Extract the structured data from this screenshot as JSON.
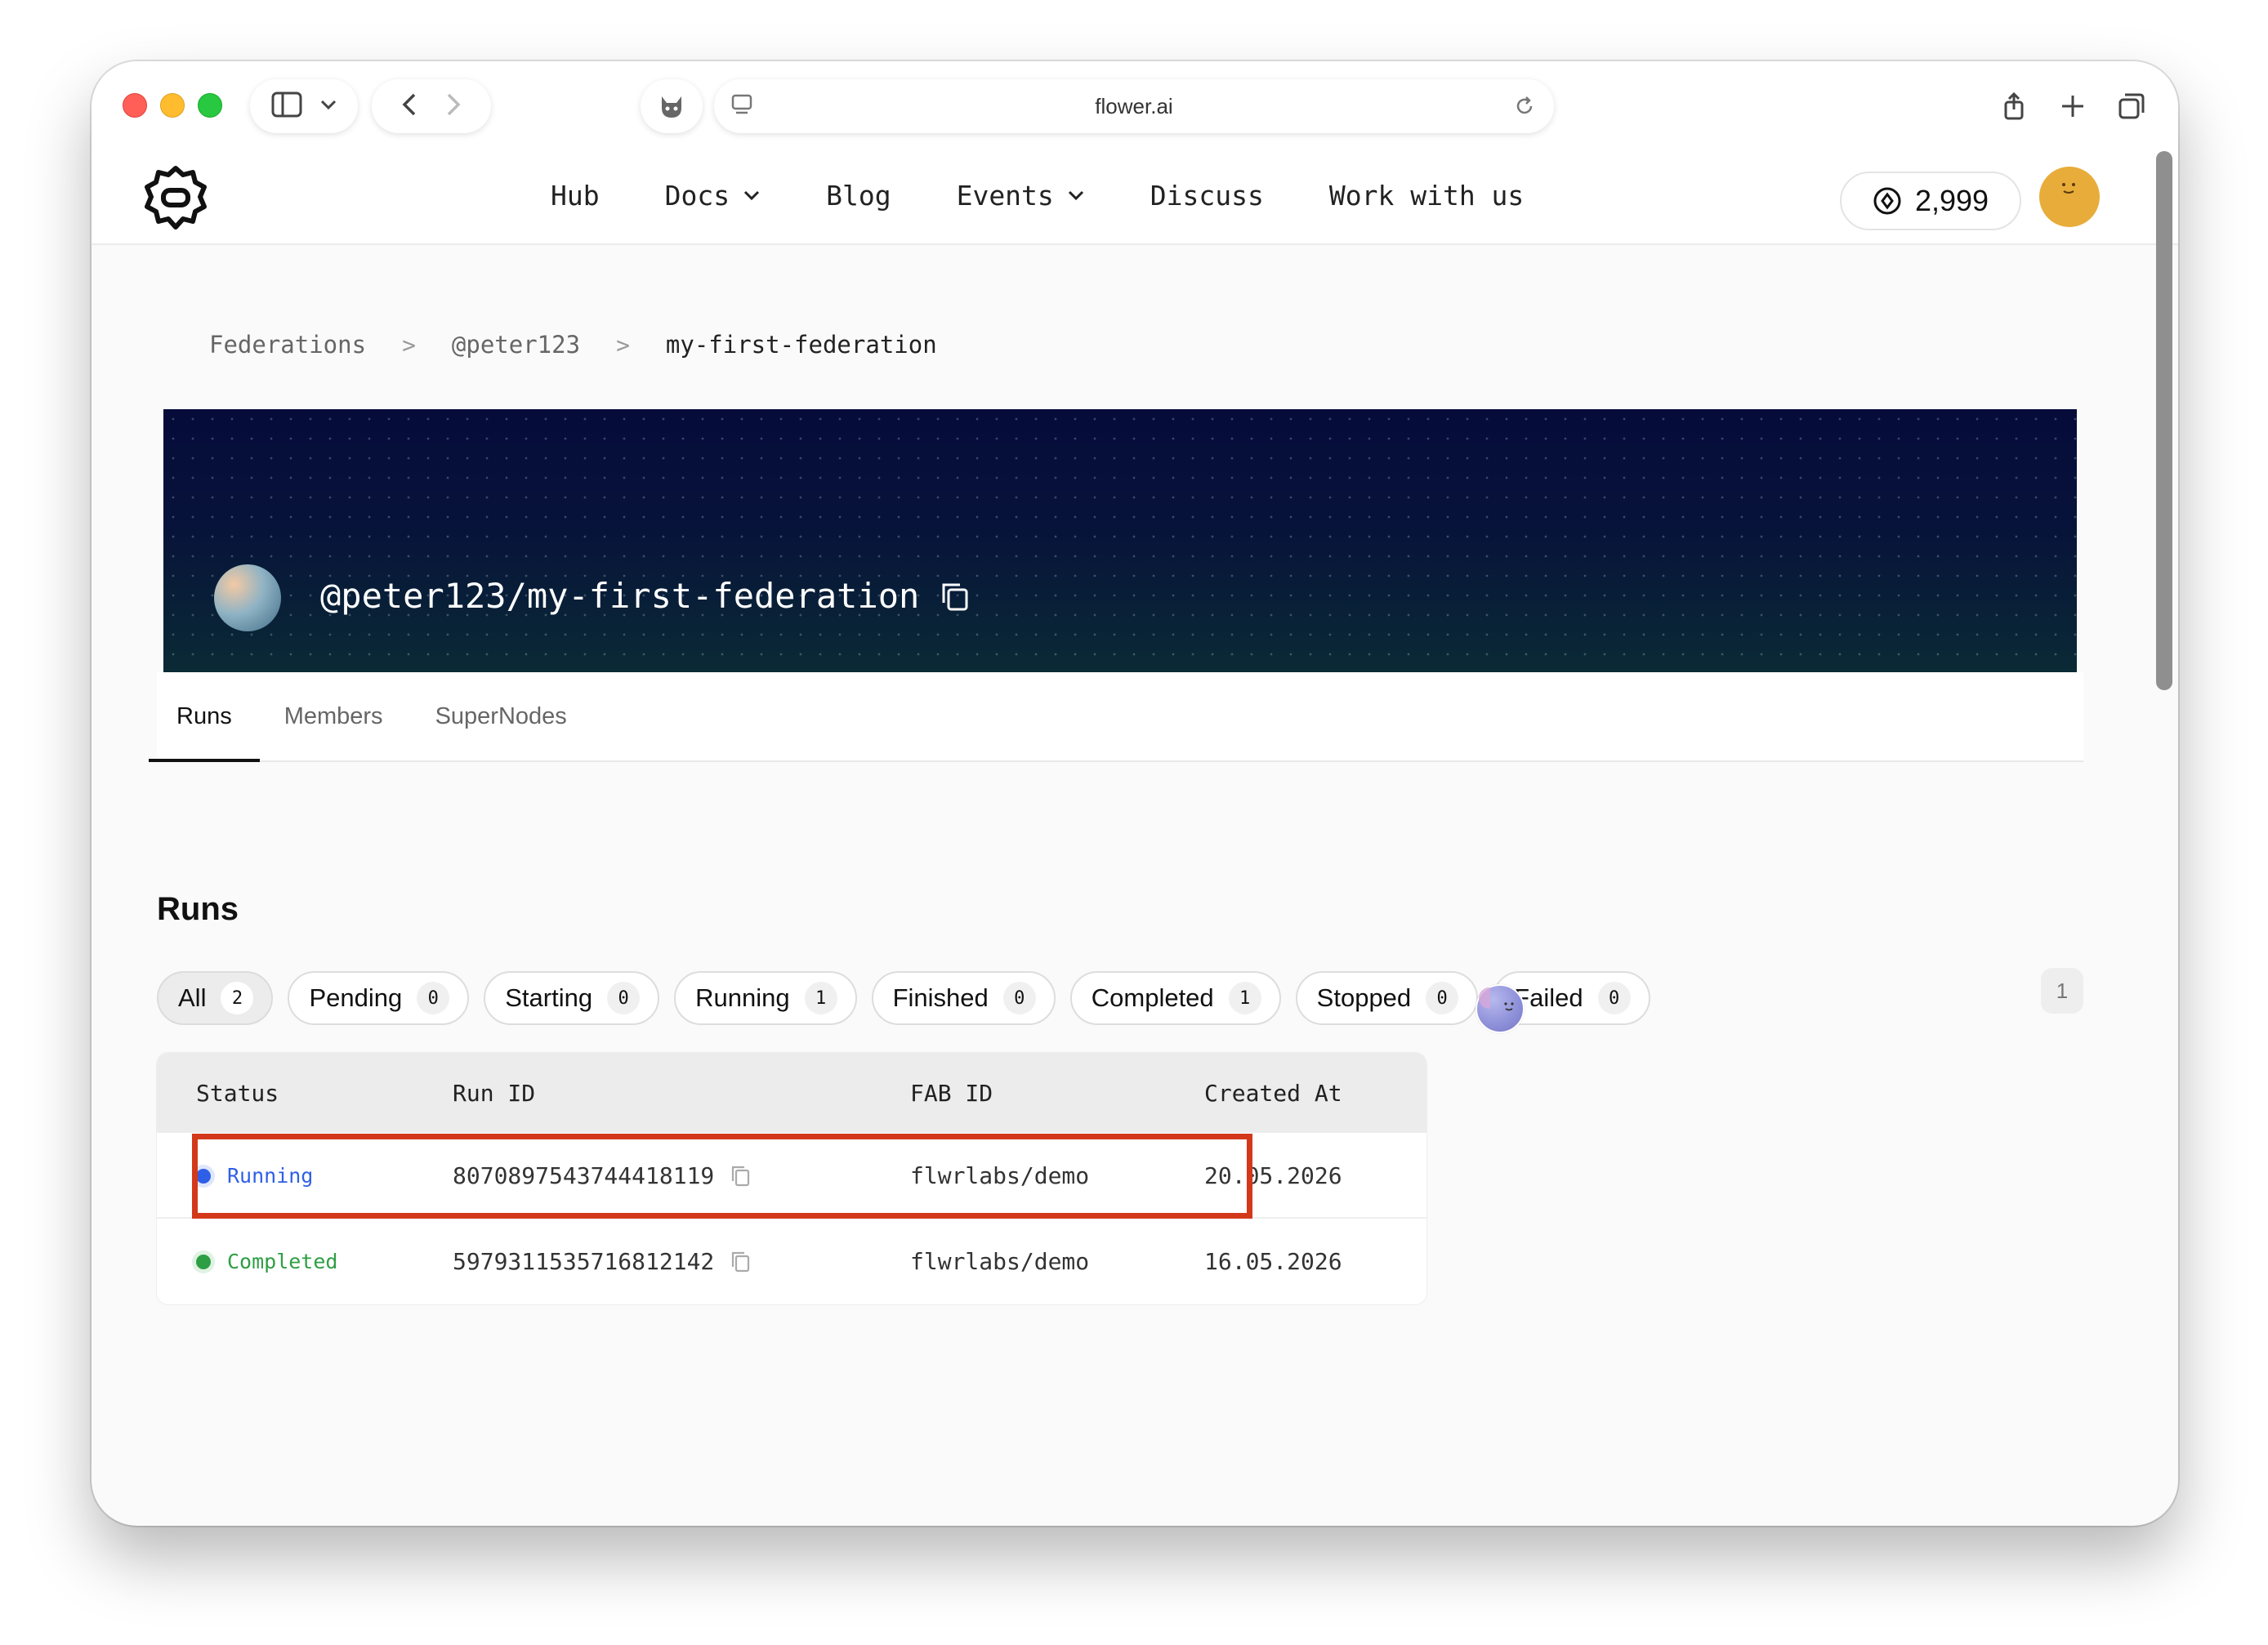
{
  "browser": {
    "url": "flower.ai"
  },
  "nav": {
    "items": [
      "Hub",
      "Docs",
      "Blog",
      "Events",
      "Discuss",
      "Work with us"
    ]
  },
  "credits": "2,999",
  "breadcrumb": {
    "items": [
      "Federations",
      "@peter123",
      "my-first-federation"
    ],
    "separator": ">"
  },
  "federation": {
    "title": "@peter123/my-first-federation"
  },
  "tabs": [
    "Runs",
    "Members",
    "SuperNodes"
  ],
  "runs": {
    "title": "Runs",
    "filters": [
      {
        "label": "All",
        "count": "2"
      },
      {
        "label": "Pending",
        "count": "0"
      },
      {
        "label": "Starting",
        "count": "0"
      },
      {
        "label": "Running",
        "count": "1"
      },
      {
        "label": "Finished",
        "count": "0"
      },
      {
        "label": "Completed",
        "count": "1"
      },
      {
        "label": "Stopped",
        "count": "0"
      },
      {
        "label": "Failed",
        "count": "0"
      }
    ],
    "page": "1",
    "columns": [
      "Status",
      "Run ID",
      "FAB ID",
      "Created At"
    ],
    "rows": [
      {
        "status": "Running",
        "status_color": "#2f5fe6",
        "run_id": "8070897543744418119",
        "fab_id": "flwrlabs/demo",
        "created_at": "20.05.2026"
      },
      {
        "status": "Completed",
        "status_color": "#2e9e44",
        "run_id": "5979311535716812142",
        "fab_id": "flwrlabs/demo",
        "created_at": "16.05.2026"
      }
    ]
  },
  "colors": {
    "highlight": "#d4381a",
    "avatar": "#e8ac3a"
  }
}
